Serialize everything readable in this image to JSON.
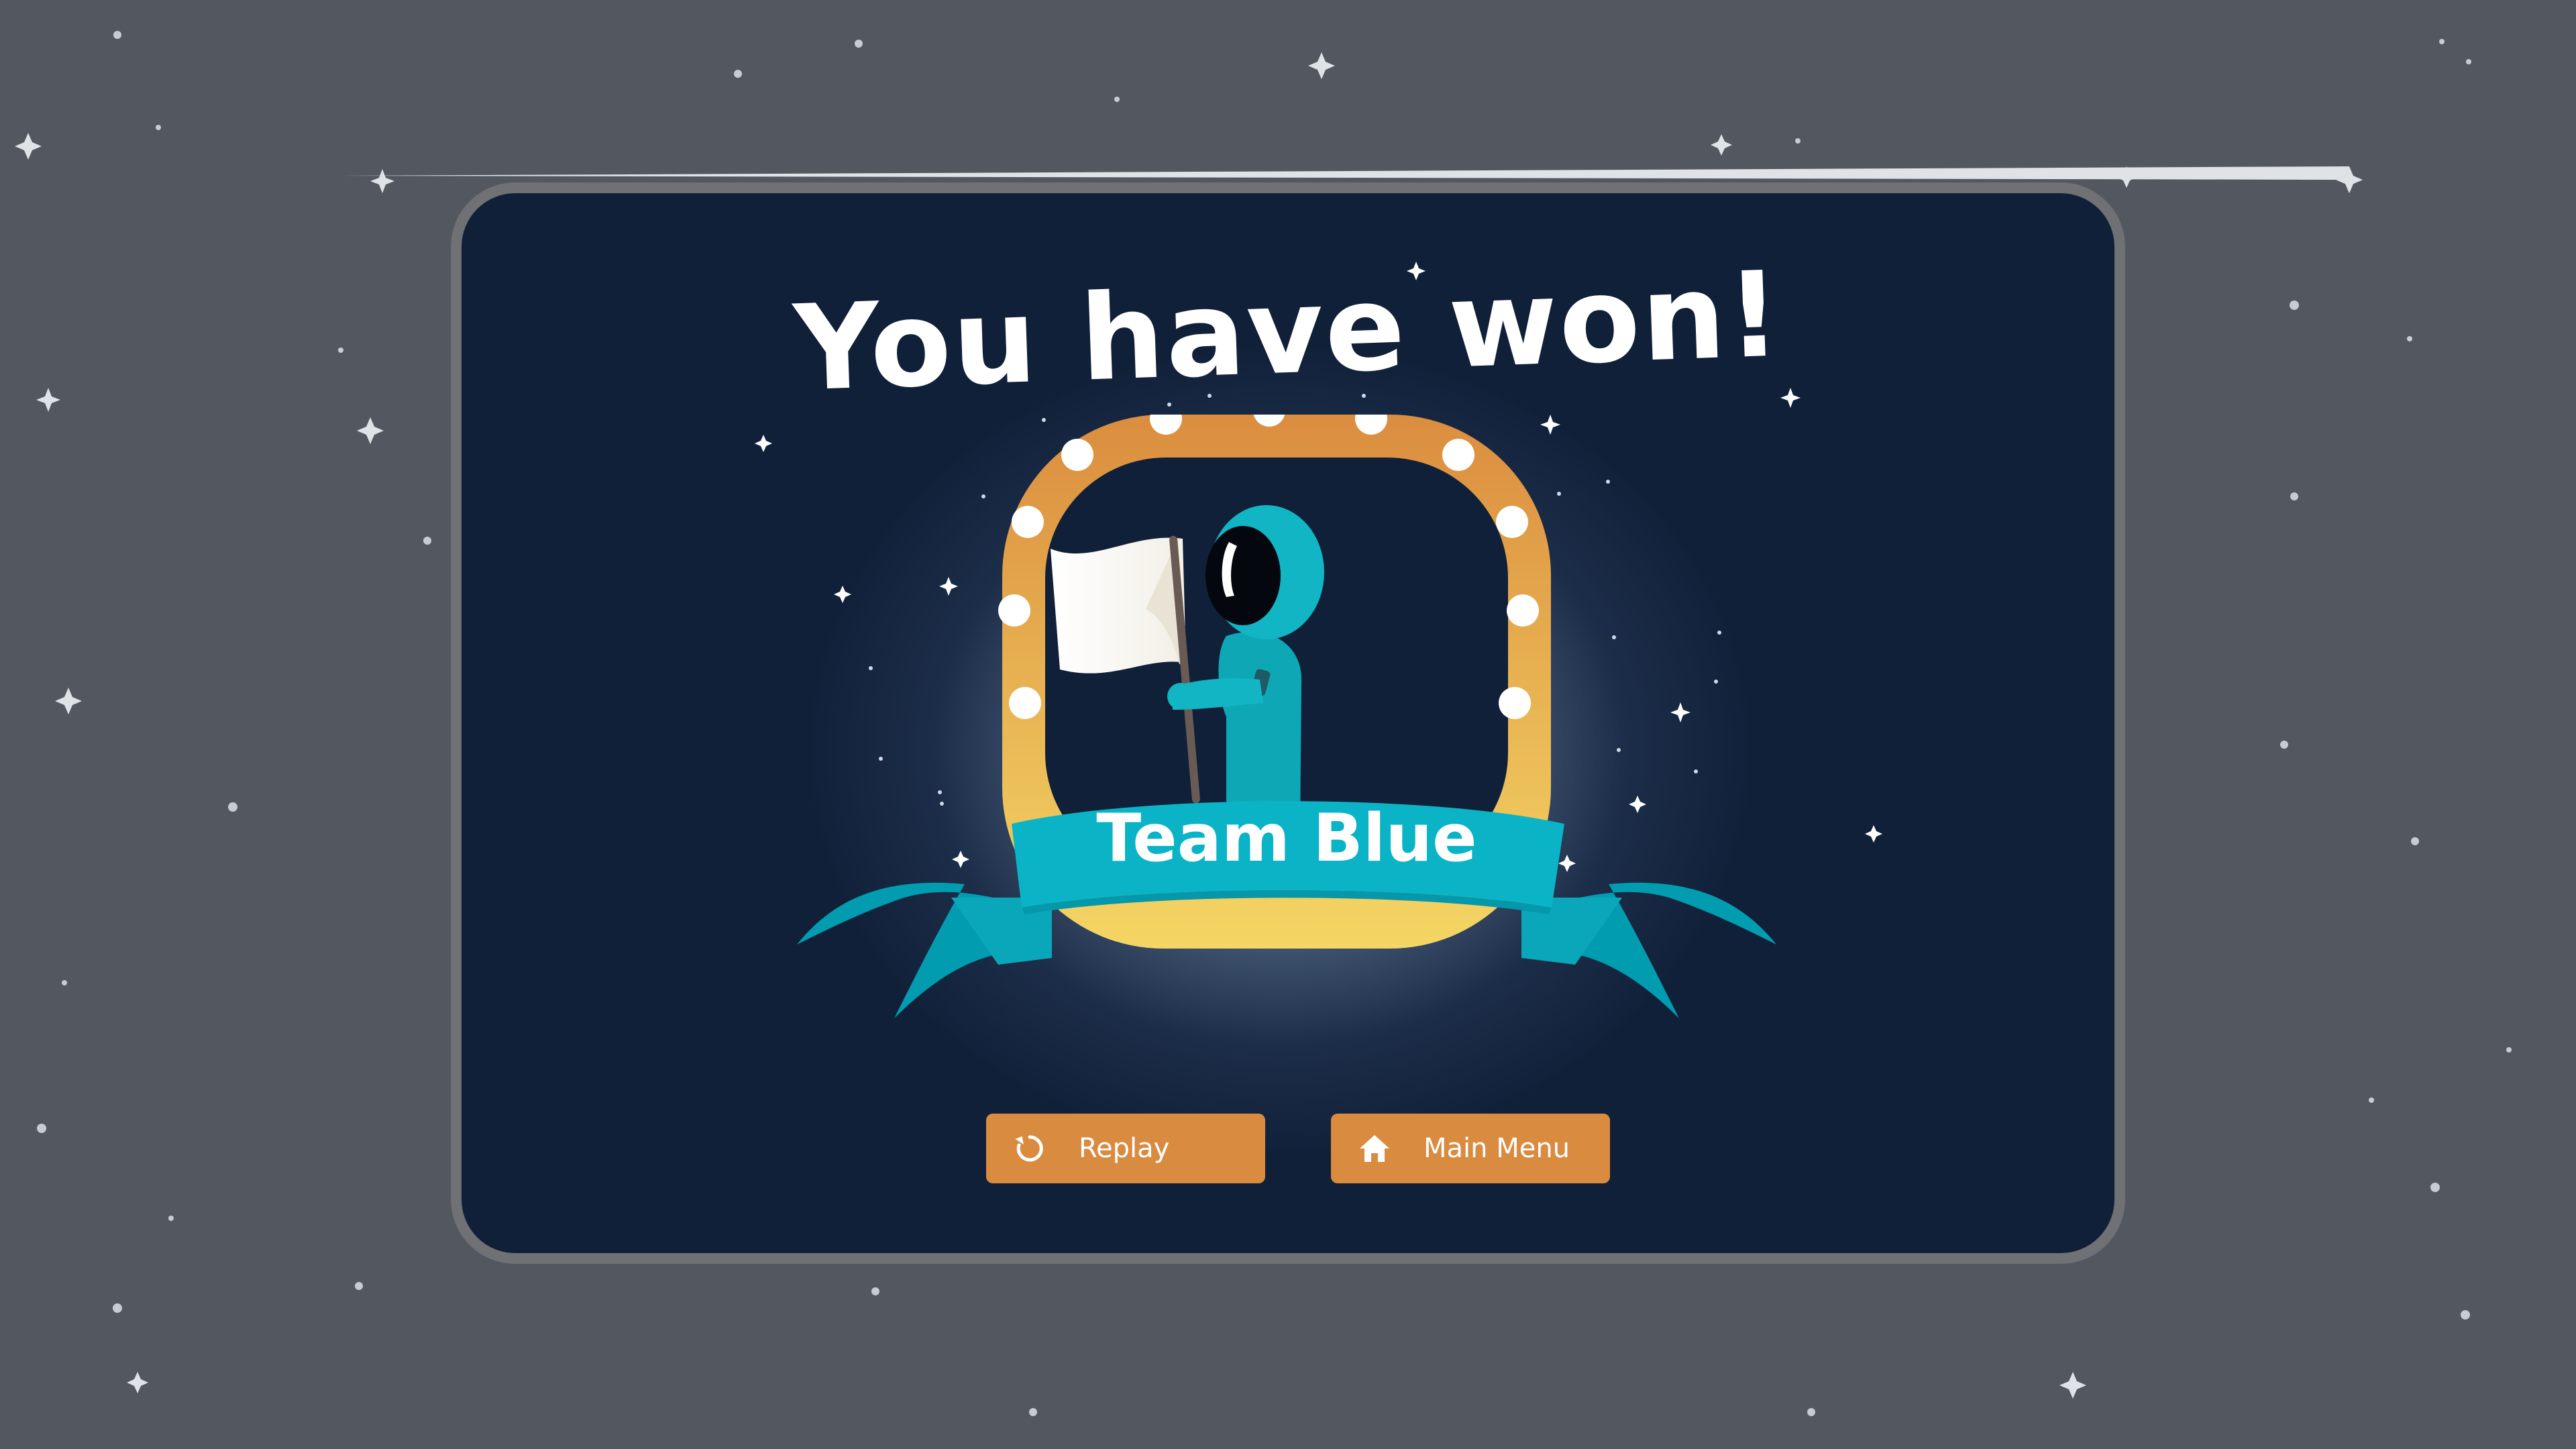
{
  "screen": {
    "title": "You have won!",
    "winner_label": "Team Blue"
  },
  "buttons": {
    "replay": {
      "label": "Replay",
      "icon": "replay-icon"
    },
    "main_menu": {
      "label": "Main Menu",
      "icon": "home-icon"
    }
  },
  "colors": {
    "background": "#535860",
    "panel": "#112039",
    "panel_border": "#6f7175",
    "button": "#d98b3f",
    "frame_top": "#db8d3f",
    "frame_bottom": "#f4d664",
    "ribbon": "#0ab4c6",
    "astronaut": "#12b5c4"
  }
}
